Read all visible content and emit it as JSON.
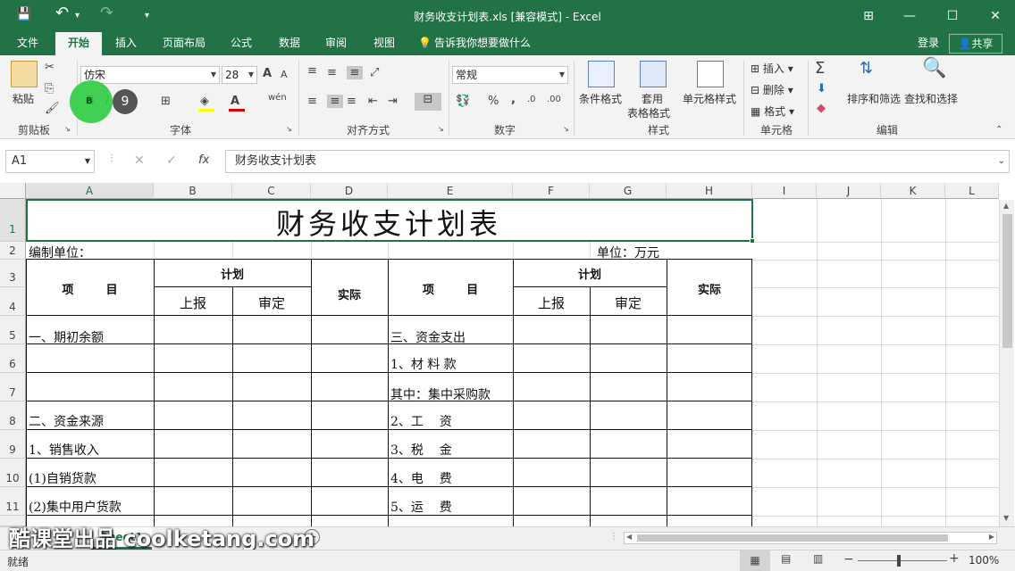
{
  "window": {
    "title": "财务收支计划表.xls  [兼容模式] - Excel",
    "qat_save": "💾",
    "qat_undo": "↶",
    "qat_redo": "↷",
    "qat_more": "▾",
    "min": "—",
    "max": "☐",
    "close": "✕",
    "ribbon_display": "⊞"
  },
  "menu": {
    "tabs": [
      "文件",
      "开始",
      "插入",
      "页面布局",
      "公式",
      "数据",
      "审阅",
      "视图"
    ],
    "tell_me": "告诉我你想要做什么",
    "login": "登录",
    "share": "共享"
  },
  "ribbon": {
    "clipboard": {
      "group": "剪贴板",
      "paste": "粘贴"
    },
    "font": {
      "group": "字体",
      "name": "仿宋",
      "size": "28",
      "bold": "B",
      "italic": "I",
      "underline": "U",
      "grow": "A",
      "shrink": "A",
      "wen": "wén",
      "font_color": "A"
    },
    "align": {
      "group": "对齐方式"
    },
    "number": {
      "group": "数字",
      "format": "常规",
      "percent": "%",
      "comma": ","
    },
    "styles": {
      "group": "样式",
      "cond": "条件格式",
      "table_fmt_1": "套用",
      "table_fmt_2": "表格格式",
      "cell_style": "单元格样式"
    },
    "cells": {
      "group": "单元格",
      "insert": "插入",
      "delete": "删除",
      "format": "格式"
    },
    "editing": {
      "group": "编辑",
      "sigma": "Σ",
      "sort": "排序和筛选",
      "find": "查找和选择"
    }
  },
  "formula": {
    "name_box": "A1",
    "cancel": "✕",
    "enter": "✓",
    "fx": "fx",
    "content": "财务收支计划表"
  },
  "columns": [
    "A",
    "B",
    "C",
    "D",
    "E",
    "F",
    "G",
    "H",
    "I",
    "J",
    "K",
    "L"
  ],
  "rows": [
    "1",
    "2",
    "3",
    "4",
    "5",
    "6",
    "7",
    "8",
    "9",
    "10",
    "11"
  ],
  "cells": {
    "title": "财务收支计划表",
    "unit_left": "编制单位：",
    "unit_right": "单位：万元",
    "item_left": "项        目",
    "plan_left": "计划",
    "report_left": "上报",
    "approve_left": "审定",
    "actual_left": "实际",
    "item_right": "项        目",
    "plan_right": "计划",
    "report_right": "上报",
    "approve_right": "审定",
    "actual_right": "实际",
    "r5a": "一、期初余额",
    "r5e": "三、资金支出",
    "r6e": "1、材 料 款",
    "r7e": "其中：集中采购款",
    "r8a": "二、资金来源",
    "r8e": "2、工    资",
    "r9a": "1、销售收入",
    "r9e": "3、税    金",
    "r10a": "(1)自销货款",
    "r10e": "4、电    费",
    "r11a": "(2)集中用户货款",
    "r11e": "5、运    费"
  },
  "watermark": "酷课堂出品 coolketang.com",
  "click_indicator": "9",
  "sheet_tab": "Sheet1",
  "status": {
    "ready": "就绪",
    "zoom": "100%"
  }
}
